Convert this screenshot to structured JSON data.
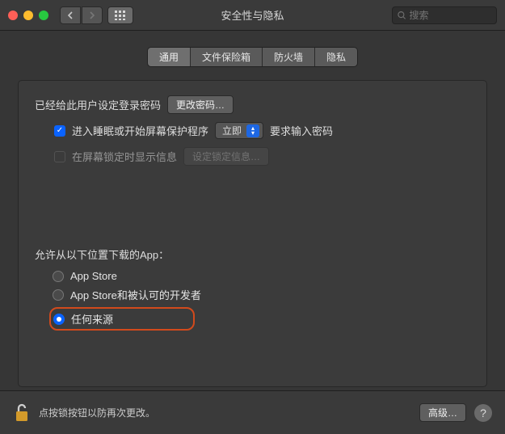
{
  "window": {
    "title": "安全性与隐私"
  },
  "search": {
    "placeholder": "搜索"
  },
  "tabs": {
    "general": "通用",
    "filevault": "文件保险箱",
    "firewall": "防火墙",
    "privacy": "隐私"
  },
  "password_section": {
    "has_set_label": "已经给此用户设定登录密码",
    "change_button": "更改密码…",
    "sleep_checkbox_label_pre": "进入睡眠或开始屏幕保护程序",
    "sleep_select_value": "立即",
    "sleep_checkbox_label_post": "要求输入密码",
    "lock_message_label": "在屏幕锁定时显示信息",
    "set_lock_message_button": "设定锁定信息…"
  },
  "gatekeeper": {
    "title": "允许从以下位置下载的App：",
    "option_appstore": "App Store",
    "option_identified": "App Store和被认可的开发者",
    "option_anywhere": "任何来源"
  },
  "footer": {
    "lock_text": "点按锁按钮以防再次更改。",
    "advanced_button": "高级…"
  }
}
